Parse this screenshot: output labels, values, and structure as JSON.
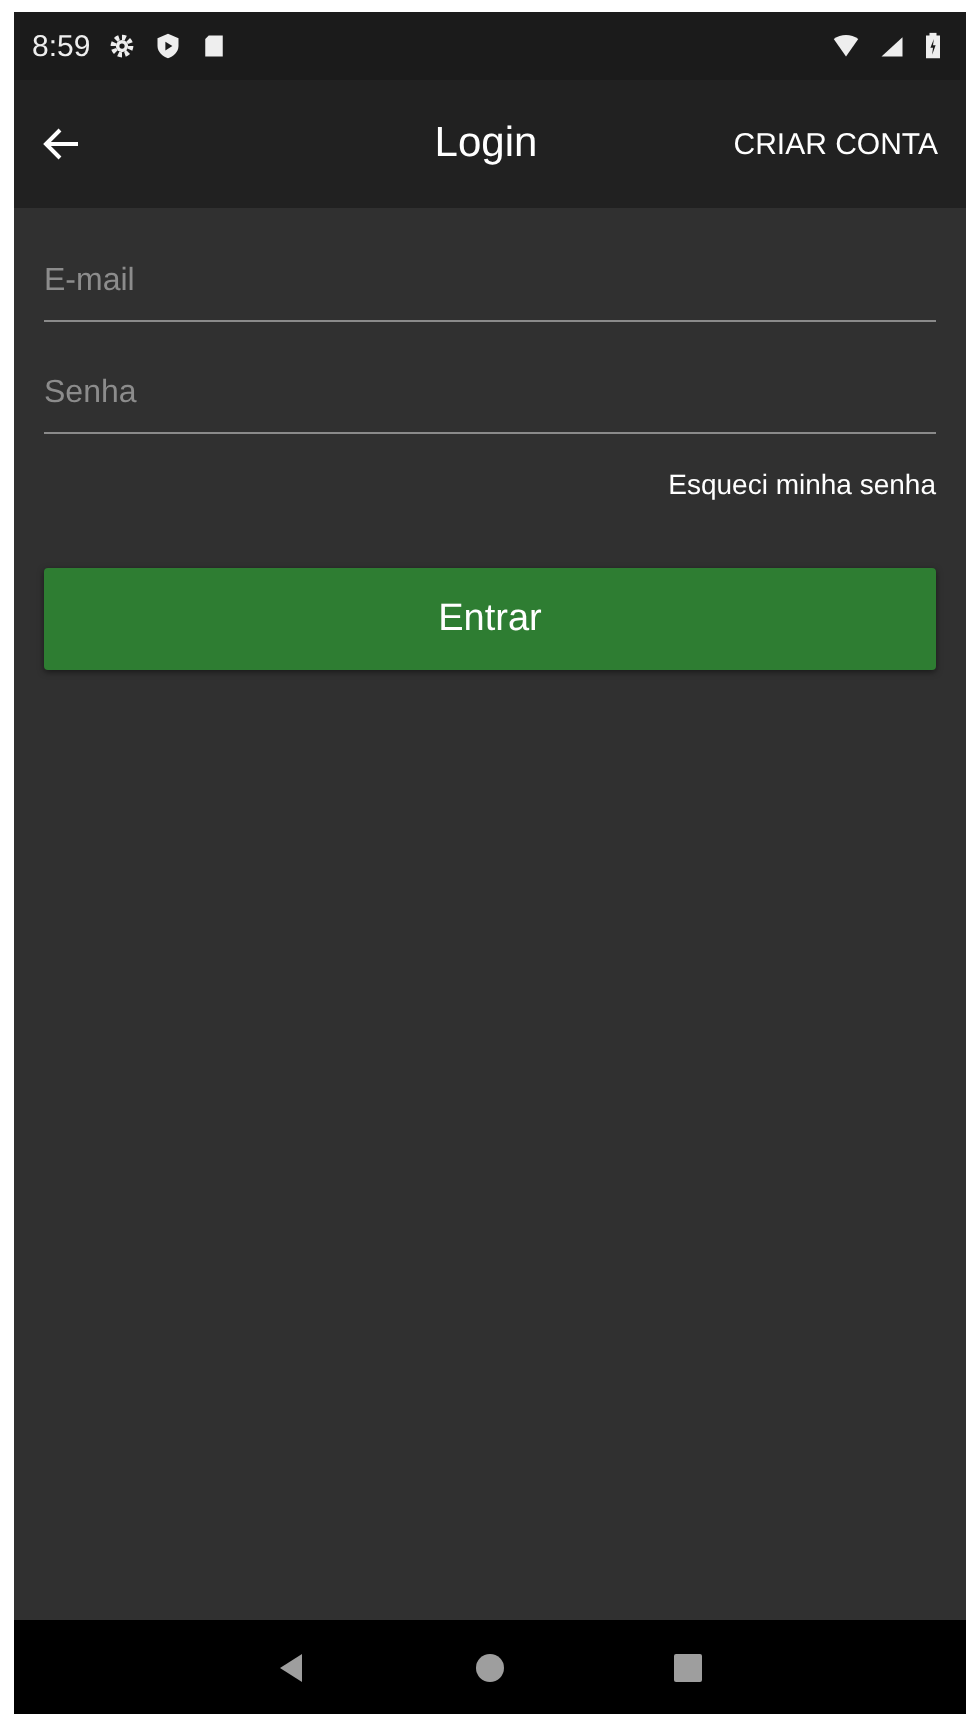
{
  "status_bar": {
    "time": "8:59"
  },
  "app_bar": {
    "title": "Login",
    "action": "CRIAR CONTA"
  },
  "fields": [
    {
      "placeholder": "E-mail"
    },
    {
      "placeholder": "Senha"
    }
  ],
  "forgot_link": "Esqueci minha senha",
  "submit_button": "Entrar"
}
